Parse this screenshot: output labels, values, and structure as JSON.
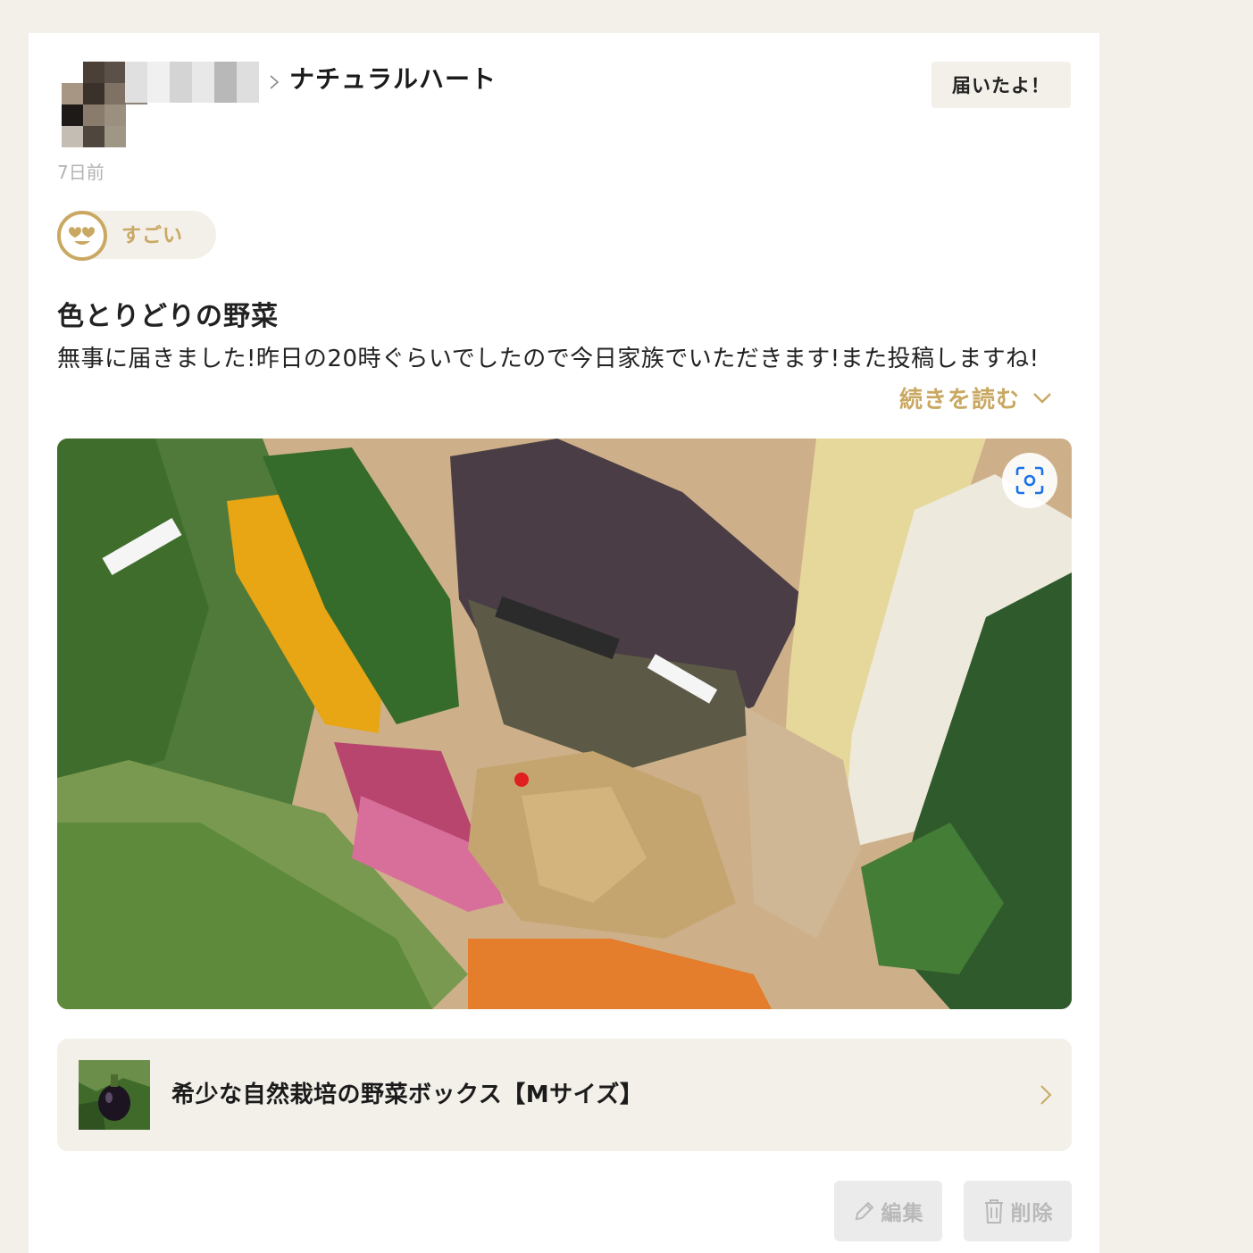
{
  "header": {
    "store_name": "ナチュラルハート",
    "received_label": "届いたよ！",
    "timestamp": "7日前"
  },
  "reaction": {
    "icon": "heart-eyes-face-icon",
    "label": "すごい"
  },
  "post": {
    "title": "色とりどりの野菜",
    "body": "無事に届きました!昨日の20時ぐらいでしたので今日家族でいただきます!また投稿しますね!",
    "read_more": "続きを読む"
  },
  "product": {
    "name": "希少な自然栽培の野菜ボックス【Mサイズ】"
  },
  "actions": {
    "edit_label": "編集",
    "delete_label": "削除"
  },
  "colors": {
    "accent": "#c9a862",
    "background": "#f3f0ea",
    "disabled_text": "#b9b9b9"
  }
}
